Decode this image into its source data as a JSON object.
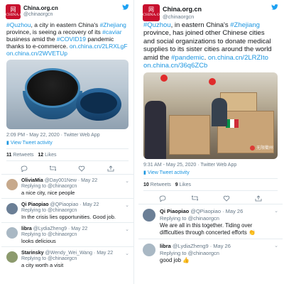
{
  "left": {
    "account": {
      "name": "China.org.cn",
      "handle": "@chinaorgcn",
      "logo_big": "网",
      "logo_small": "CHINA.ORG.CN"
    },
    "text": {
      "p1": "",
      "tag1": "#Quzhou",
      "p2": ", a city in eastern China's ",
      "tag2": "#Zhejiang",
      "p3": " province, is seeing a recovery of its ",
      "tag3": "#caviar",
      "p4": " business amid the ",
      "tag4": "#COVID19",
      "p5": " pandemic thanks to e-commerce. ",
      "link1": "on.china.cn/2LRXLgF",
      "link2": "on.china.cn/2WVETUp"
    },
    "meta": "2:09 PM - May 22, 2020 · Twitter Web App",
    "activity": "View Tweet activity",
    "stats": {
      "retweets": "11",
      "retweets_label": "Retweets",
      "likes": "12",
      "likes_label": "Likes"
    },
    "replies": [
      {
        "name": "OliviaMia",
        "handle": "@Day001New · May 22",
        "to": "Replying to @chinaorgcn",
        "body": "a nice city, nice people"
      },
      {
        "name": "Qi Piaopiao",
        "handle": "@QPiaopiao · May 22",
        "to": "Replying to @chinaorgcn",
        "body": "In the crisis lies opportunities. Good job."
      },
      {
        "name": "libra",
        "handle": "@LydiaZheng9 · May 22",
        "to": "Replying to @chinaorgcn",
        "body": "looks delicious"
      },
      {
        "name": "Starinsky",
        "handle": "@Wendy_Wei_Wang · May 22",
        "to": "Replying to @chinaorgcn",
        "body": "a city worth a visit"
      }
    ]
  },
  "right": {
    "account": {
      "name": "China.org.cn",
      "handle": "@chinaorgcn",
      "logo_big": "网",
      "logo_small": "CHINA.ORG.CN"
    },
    "text": {
      "tag1": "#Quzhou",
      "p2": ", in eastern China's ",
      "tag2": "#Zhejiang",
      "p3": " province, has joined other Chinese cities and social organizations to donate medical supplies to its sister cities around the world amid the ",
      "tag3": "#pandemic",
      "p4": ". ",
      "link1": "on.china.cn/2LRZIto",
      "link2": "on.china.cn/36q6ZCb"
    },
    "watermark": "无限衢州",
    "meta": "9:31 AM - May 25, 2020 · Twitter Web App",
    "activity": "View Tweet activity",
    "stats": {
      "retweets": "10",
      "retweets_label": "Retweets",
      "likes": "9",
      "likes_label": "Likes"
    },
    "replies": [
      {
        "name": "Qi Piaopiao",
        "handle": "@QPiaopiao · May 26",
        "to": "Replying to @chinaorgcn",
        "body": "We are all in this together. Tiding over difficulties through concerted efforts"
      },
      {
        "name": "libra",
        "handle": "@LydiaZheng9 · May 26",
        "to": "Replying to @chinaorgcn",
        "body": "good job"
      }
    ]
  },
  "colors": {
    "link": "#1b95e0",
    "brand": "#c8102e",
    "muted": "#657786"
  }
}
